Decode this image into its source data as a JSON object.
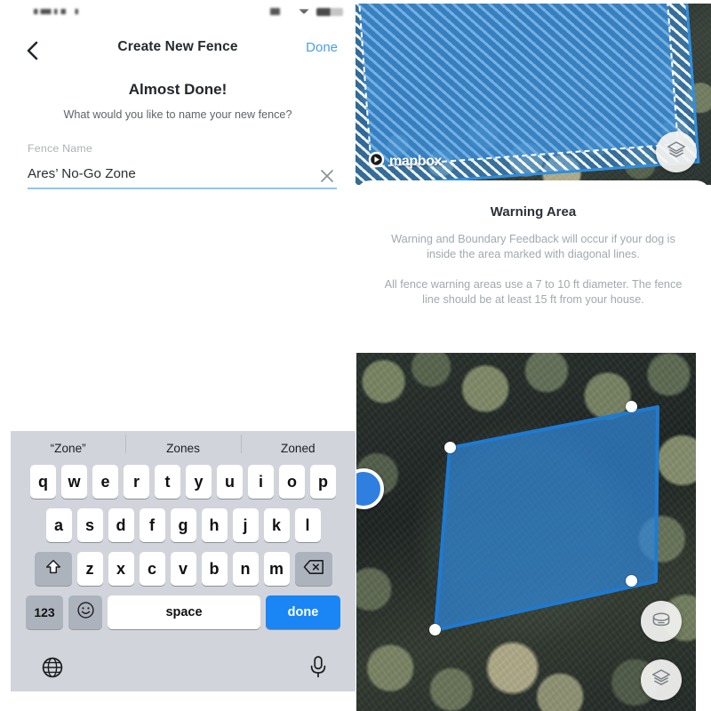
{
  "app": {
    "statusbar": {
      "visible": true
    }
  },
  "form_screen": {
    "nav": {
      "back_icon": "chevron-left-icon",
      "title": "Create New Fence",
      "done_label": "Done",
      "done_color": "#4b9fe0"
    },
    "heading": "Almost Done!",
    "subheading": "What would you like to name your new fence?",
    "fence_name_field": {
      "label": "Fence Name",
      "value": "Ares’ No-Go Zone",
      "placeholder": "Fence Name",
      "clear_icon": "close-icon",
      "underline_color": "#8fc6ef"
    }
  },
  "warning_screen": {
    "map": {
      "attribution": "mapbox",
      "attribution_icon": "mapbox-logo-icon",
      "layers_icon": "layers-icon",
      "fence_fill_color": "#388cd6",
      "fence_stroke_color": "#2f8fe0"
    },
    "card": {
      "title": "Warning Area",
      "paragraph_1": "Warning and Boundary Feedback will occur if your dog is inside the area marked with diagonal lines.",
      "paragraph_2": "All fence warning areas use a 7 to 10 ft diameter. The fence line should be at least 15 ft from your house.",
      "text_color": "#a3a9ae"
    }
  },
  "keyboard": {
    "suggestions": [
      "“Zone”",
      "Zones",
      "Zoned"
    ],
    "row1": [
      "q",
      "w",
      "e",
      "r",
      "t",
      "y",
      "u",
      "i",
      "o",
      "p"
    ],
    "row2": [
      "a",
      "s",
      "d",
      "f",
      "g",
      "h",
      "j",
      "k",
      "l"
    ],
    "row3": [
      "z",
      "x",
      "c",
      "v",
      "b",
      "n",
      "m"
    ],
    "shift_icon": "shift-arrow-icon",
    "delete_icon": "backspace-icon",
    "numeric_label": "123",
    "emoji_icon": "emoji-smiley-icon",
    "space_label": "space",
    "done_label": "done",
    "done_color": "#1a85f5",
    "globe_icon": "globe-icon",
    "mic_icon": "microphone-icon"
  },
  "fence_map_screen": {
    "location_marker_icon": "current-location-dot-icon",
    "tilt_icon": "3d-perspective-icon",
    "layers_icon": "layers-icon",
    "fence_fill_color": "#2f87d8",
    "fence_stroke_color": "#1f7ad0",
    "vertex_count": 4
  }
}
